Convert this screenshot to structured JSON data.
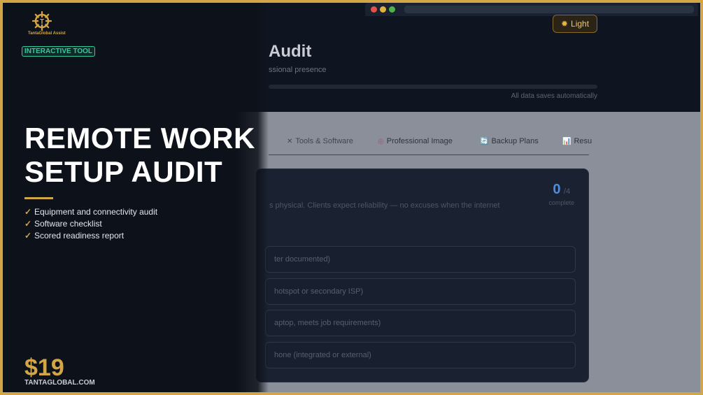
{
  "brand": {
    "logo_text": "TantaGlobal Assist",
    "tag": "INTERACTIVE TOOL",
    "site": "TANTAGLOBAL.COM",
    "accent": "#d2a646"
  },
  "promo": {
    "headline_line1": "REMOTE WORK",
    "headline_line2": "SETUP AUDIT",
    "bullets": [
      "Equipment and connectivity audit",
      "Software checklist",
      "Scored readiness report"
    ],
    "price": "$19"
  },
  "app": {
    "theme_button": "Light",
    "title_fragment": "Audit",
    "subtitle_fragment": "ssional presence",
    "autosave": "All data saves automatically",
    "progress": 0,
    "tabs": [
      {
        "icon": "tools-icon",
        "glyph": "✕",
        "label": "Tools & Software"
      },
      {
        "icon": "professional-image-icon",
        "glyph": "◎",
        "label": "Professional Image"
      },
      {
        "icon": "backup-icon",
        "glyph": "🔄",
        "label": "Backup Plans"
      },
      {
        "icon": "results-icon",
        "glyph": "📊",
        "label": "Resu"
      }
    ],
    "card": {
      "description": "s physical. Clients expect reliability — no excuses when the internet",
      "count": "0",
      "total": "/4",
      "count_label": "complete",
      "items": [
        "ter documented)",
        "hotspot or secondary ISP)",
        "aptop, meets job requirements)",
        "hone (integrated or external)"
      ]
    }
  },
  "colors": {
    "mac_red": "#e0524a",
    "mac_yellow": "#e2b23a",
    "mac_green": "#4cb44a"
  }
}
